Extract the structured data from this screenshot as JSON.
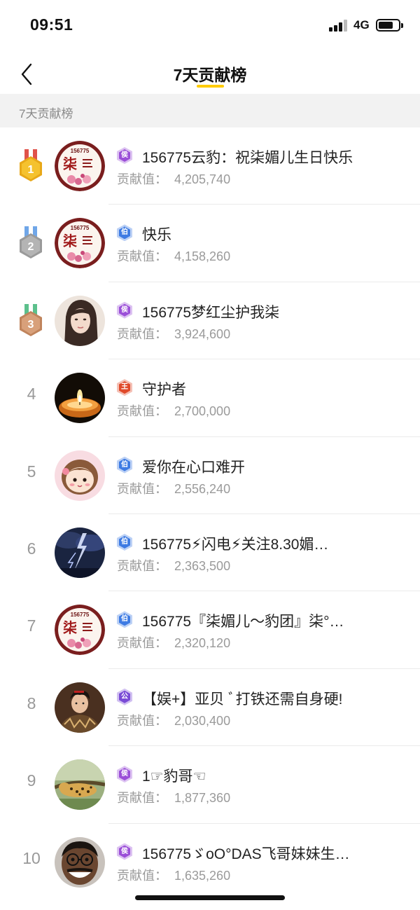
{
  "status_bar": {
    "time": "09:51",
    "network": "4G"
  },
  "nav": {
    "title": "7天贡献榜"
  },
  "section_header": "7天贡献榜",
  "contribution_label": "贡献值：",
  "ranks": [
    {
      "rank": "1",
      "medal": "gold",
      "badge": "侯",
      "badge_color": "#9B4FD8",
      "name": "156775云豹：祝柒媚儿生日快乐",
      "value": "4,205,740",
      "avatar": "logo"
    },
    {
      "rank": "2",
      "medal": "silver",
      "badge": "伯",
      "badge_color": "#3E7BE3",
      "name": "快乐",
      "value": "4,158,260",
      "avatar": "logo"
    },
    {
      "rank": "3",
      "medal": "bronze",
      "badge": "侯",
      "badge_color": "#9B4FD8",
      "name": "156775梦红尘护我柒",
      "value": "3,924,600",
      "avatar": "woman"
    },
    {
      "rank": "4",
      "medal": "",
      "badge": "王",
      "badge_color": "#E04A2A",
      "name": "守护者",
      "value": "2,700,000",
      "avatar": "candle"
    },
    {
      "rank": "5",
      "medal": "",
      "badge": "伯",
      "badge_color": "#3E7BE3",
      "name": "爱你在心口难开",
      "value": "2,556,240",
      "avatar": "cartoon"
    },
    {
      "rank": "6",
      "medal": "",
      "badge": "伯",
      "badge_color": "#3E7BE3",
      "name": "156775⚡闪电⚡关注8.30媚…",
      "value": "2,363,500",
      "avatar": "lightning"
    },
    {
      "rank": "7",
      "medal": "",
      "badge": "伯",
      "badge_color": "#3E7BE3",
      "name": "156775『柒媚儿～豹团』柒°…",
      "value": "2,320,120",
      "avatar": "logo"
    },
    {
      "rank": "8",
      "medal": "",
      "badge": "公",
      "badge_color": "#7A4BD6",
      "name": "【娱+】亚贝 ﾞ打铁还需自身硬!",
      "value": "2,030,400",
      "avatar": "man"
    },
    {
      "rank": "9",
      "medal": "",
      "badge": "侯",
      "badge_color": "#9B4FD8",
      "name": "1☞豹哥☜",
      "value": "1,877,360",
      "avatar": "leopard"
    },
    {
      "rank": "10",
      "medal": "",
      "badge": "侯",
      "badge_color": "#9B4FD8",
      "name": "156775ゞoO°DAS飞哥妹妹生…",
      "value": "1,635,260",
      "avatar": "face"
    }
  ],
  "avatar_logo_text": {
    "num": "156775",
    "char": "柒"
  }
}
